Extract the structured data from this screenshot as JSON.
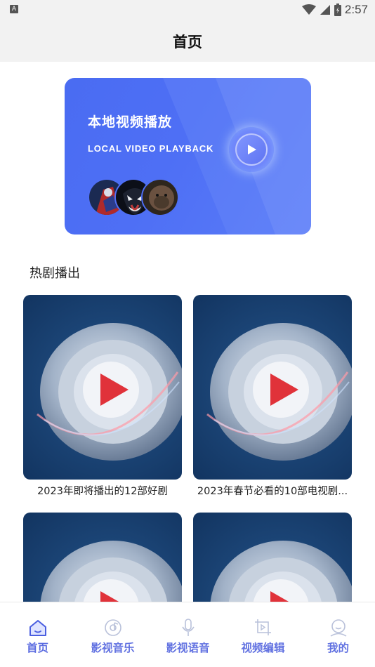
{
  "status": {
    "indicator": "A",
    "time": "2:57"
  },
  "header": {
    "title": "首页"
  },
  "banner": {
    "title": "本地视频播放",
    "subtitle": "LOCAL VIDEO PLAYBACK"
  },
  "section": {
    "title": "热剧播出"
  },
  "cards": [
    {
      "label": "2023年即将播出的12部好剧"
    },
    {
      "label": "2023年春节必看的10部电视剧..."
    },
    {
      "label": ""
    },
    {
      "label": ""
    }
  ],
  "tabs": [
    {
      "label": "首页",
      "icon": "home-icon",
      "active": true
    },
    {
      "label": "影视音乐",
      "icon": "music-disc-icon",
      "active": false
    },
    {
      "label": "影视语音",
      "icon": "microphone-icon",
      "active": false
    },
    {
      "label": "视频编辑",
      "icon": "crop-edit-icon",
      "active": false
    },
    {
      "label": "我的",
      "icon": "user-icon",
      "active": false
    }
  ],
  "colors": {
    "accent": "#5a6be0",
    "banner": "#4e6ff5",
    "thumb_bg": "#1c4678"
  }
}
